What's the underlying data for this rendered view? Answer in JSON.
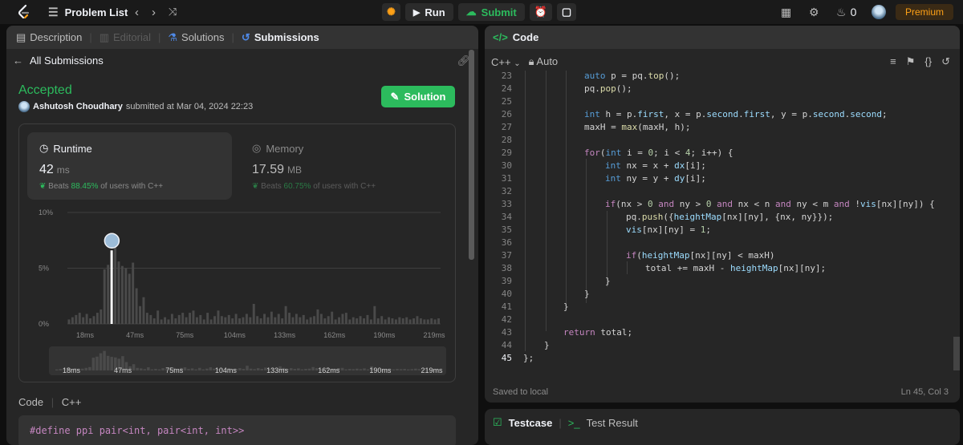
{
  "topbar": {
    "problem_list": "Problem List",
    "run_label": "Run",
    "submit_label": "Submit",
    "streak_count": "0",
    "premium_label": "Premium"
  },
  "left_tabs": [
    {
      "label": "Description"
    },
    {
      "label": "Editorial"
    },
    {
      "label": "Solutions"
    },
    {
      "label": "Submissions"
    }
  ],
  "submission": {
    "back_label": "All Submissions",
    "status": "Accepted",
    "author": "Ashutosh Choudhary",
    "submitted_text": "submitted at Mar 04, 2024 22:23",
    "solution_button": "Solution"
  },
  "runtime": {
    "label": "Runtime",
    "value": "42",
    "unit": "ms",
    "beats_word": "Beats",
    "beats_pct": "88.45%",
    "beats_suffix": "of users with C++"
  },
  "memory": {
    "label": "Memory",
    "value": "17.59",
    "unit": "MB",
    "beats_word": "Beats",
    "beats_pct": "60.75%",
    "beats_suffix": "of users with C++"
  },
  "chart_data": {
    "type": "bar",
    "y_ticks": [
      "10%",
      "5%",
      "0%"
    ],
    "x_ticks": [
      "18ms",
      "47ms",
      "75ms",
      "104ms",
      "133ms",
      "162ms",
      "190ms",
      "219ms"
    ],
    "ylim": [
      0,
      10
    ],
    "grid": true,
    "highlight_index": 12,
    "values": [
      0.4,
      0.6,
      0.8,
      1.0,
      0.6,
      0.9,
      0.5,
      0.7,
      1.0,
      1.3,
      4.9,
      5.3,
      6.6,
      7.5,
      5.6,
      5.2,
      5.0,
      4.5,
      5.5,
      3.2,
      1.6,
      2.4,
      1.0,
      0.8,
      0.5,
      1.2,
      0.4,
      0.6,
      0.4,
      0.9,
      0.5,
      0.8,
      1.0,
      0.6,
      1.0,
      1.2,
      0.6,
      0.8,
      0.4,
      1.0,
      0.4,
      0.7,
      1.2,
      0.7,
      0.6,
      0.8,
      0.5,
      0.9,
      0.5,
      0.6,
      0.9,
      0.6,
      1.8,
      0.7,
      0.5,
      0.9,
      0.6,
      1.1,
      0.6,
      0.9,
      0.5,
      1.6,
      1.0,
      0.6,
      0.9,
      0.6,
      0.8,
      0.4,
      0.6,
      0.7,
      1.3,
      0.9,
      0.5,
      0.7,
      1.1,
      0.4,
      0.6,
      0.9,
      1.0,
      0.4,
      0.6,
      0.5,
      0.7,
      0.5,
      0.8,
      0.4,
      1.6,
      0.5,
      0.7,
      0.4,
      0.6,
      0.5,
      0.4,
      0.6,
      0.5,
      0.6,
      0.4,
      0.5,
      0.7,
      0.5,
      0.4,
      0.4,
      0.5,
      0.4,
      0.5
    ]
  },
  "code_section": {
    "title": "Code",
    "lang": "C++",
    "first_line": "#define ppi pair<int, pair<int, int>>"
  },
  "editor": {
    "tab_title": "Code",
    "language": "C++",
    "mode": "Auto",
    "saved_text": "Saved to local",
    "cursor_pos": "Ln 45, Col 3",
    "line_numbers": [
      "23",
      "24",
      "25",
      "26",
      "27",
      "28",
      "29",
      "30",
      "31",
      "32",
      "33",
      "34",
      "35",
      "36",
      "37",
      "38",
      "39",
      "40",
      "41",
      "42",
      "43",
      "44",
      "45"
    ]
  },
  "bottom_tabs": {
    "testcase": "Testcase",
    "result": "Test Result"
  }
}
